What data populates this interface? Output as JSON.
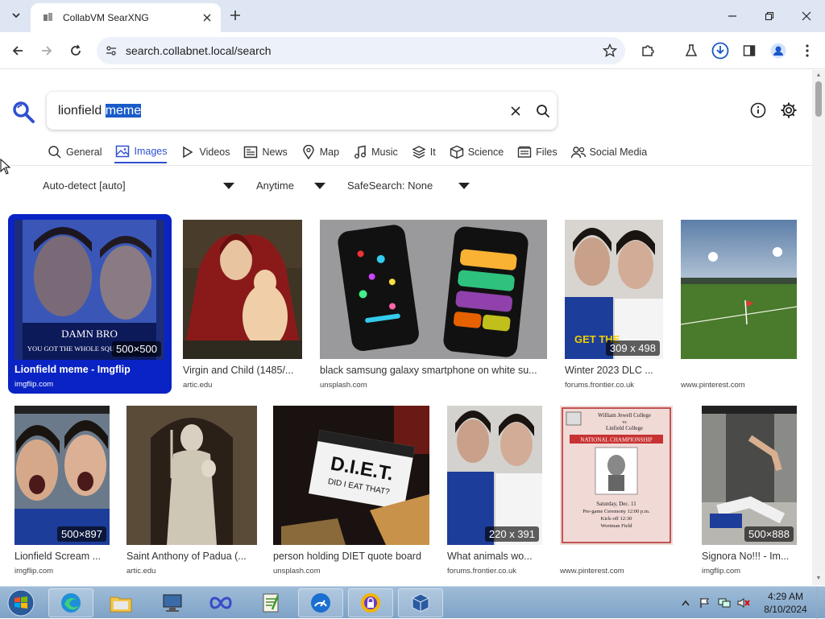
{
  "browser": {
    "tab_title": "CollabVM SearXNG",
    "url": "search.collabnet.local/search"
  },
  "search": {
    "query_plain": "lionfield ",
    "query_selected": "meme"
  },
  "categories": [
    {
      "label": "General",
      "icon": "search-icon",
      "active": false
    },
    {
      "label": "Images",
      "icon": "image-icon",
      "active": true
    },
    {
      "label": "Videos",
      "icon": "play-icon",
      "active": false
    },
    {
      "label": "News",
      "icon": "newspaper-icon",
      "active": false
    },
    {
      "label": "Map",
      "icon": "map-pin-icon",
      "active": false
    },
    {
      "label": "Music",
      "icon": "music-note-icon",
      "active": false
    },
    {
      "label": "It",
      "icon": "layers-icon",
      "active": false
    },
    {
      "label": "Science",
      "icon": "cube-icon",
      "active": false
    },
    {
      "label": "Files",
      "icon": "files-icon",
      "active": false
    },
    {
      "label": "Social Media",
      "icon": "people-icon",
      "active": false
    }
  ],
  "filters": {
    "language": "Auto-detect [auto]",
    "time": "Anytime",
    "safesearch": "SafeSearch: None"
  },
  "results_row1": [
    {
      "title": "Lionfield meme - Imgflip",
      "source": "imgflip.com",
      "resolution": "500×500"
    },
    {
      "title": "Virgin and Child (1485/...",
      "source": "artic.edu",
      "resolution": ""
    },
    {
      "title": "black samsung galaxy smartphone on white su...",
      "source": "unsplash.com",
      "resolution": ""
    },
    {
      "title": "Winter 2023 DLC ...",
      "source": "forums.frontier.co.uk",
      "resolution": "309 x 498"
    },
    {
      "title": "",
      "source": "www.pinterest.com",
      "resolution": ""
    }
  ],
  "results_row2": [
    {
      "title": "Lionfield Scream ...",
      "source": "imgflip.com",
      "resolution": "500×897"
    },
    {
      "title": "Saint Anthony of Padua (...",
      "source": "artic.edu",
      "resolution": ""
    },
    {
      "title": "person holding DIET quote board",
      "source": "unsplash.com",
      "resolution": ""
    },
    {
      "title": "What animals wo...",
      "source": "forums.frontier.co.uk",
      "resolution": "220 x 391"
    },
    {
      "title": "",
      "source": "www.pinterest.com",
      "resolution": ""
    },
    {
      "title": "Signora No!!! - Im...",
      "source": "imgflip.com",
      "resolution": "500×888"
    }
  ],
  "thumb_text": {
    "meme_line1": "DAMN BRO",
    "meme_line2": "YOU GOT THE WHOLE SQU",
    "winter_overlay": "GET THE",
    "diet_line1": "D.I.E.T.",
    "diet_line2": "DID I EAT THAT?",
    "poster_line1": "William Jewell College",
    "poster_line2": "vs",
    "poster_line3": "Linfield College",
    "poster_line4": "NATIONAL CHAMPIONSHIP",
    "poster_line5": "Saturday, Dec. 11",
    "poster_line6": "Pre-game Ceremony 12:00 p.m.",
    "poster_line7": "Kick-off 12:30",
    "poster_line8": "Wortman Field"
  },
  "taskbar": {
    "time": "4:29 AM",
    "date": "8/10/2024"
  },
  "colors": {
    "accent": "#3050d0",
    "selected_card": "#0a23c4",
    "taskbar": "#8fb0d0"
  }
}
